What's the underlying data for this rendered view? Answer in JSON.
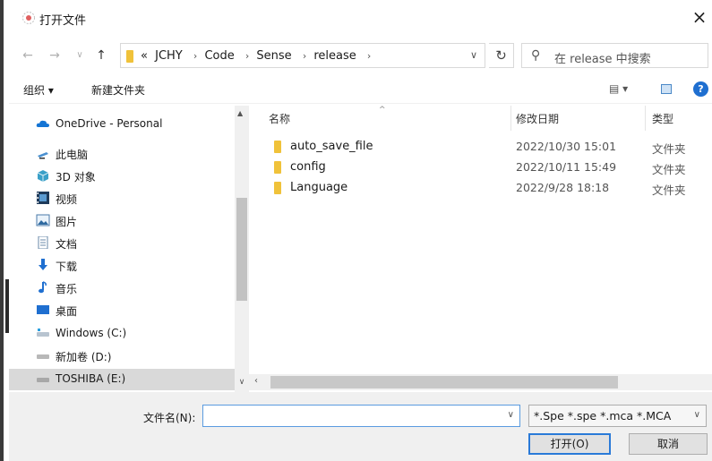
{
  "window": {
    "title": "打开文件",
    "close_label": "×"
  },
  "nav": {
    "back": "←",
    "forward": "→",
    "recent": "∨",
    "up": "↑",
    "breadcrumbs": [
      "«",
      "JCHY",
      "Code",
      "Sense",
      "release"
    ],
    "crumb_sep": "›",
    "refresh": "↻",
    "search_placeholder": "在 release 中搜索"
  },
  "toolbar": {
    "organize": "组织 ▾",
    "new_folder": "新建文件夹",
    "view": "▤ ▾",
    "help": "?"
  },
  "sidebar": {
    "items": [
      {
        "label": "OneDrive - Personal",
        "icon": "cloud-icon"
      },
      {
        "label": "此电脑",
        "icon": "computer-icon"
      },
      {
        "label": "3D 对象",
        "icon": "cube-icon"
      },
      {
        "label": "视频",
        "icon": "video-icon"
      },
      {
        "label": "图片",
        "icon": "picture-icon"
      },
      {
        "label": "文档",
        "icon": "document-icon"
      },
      {
        "label": "下载",
        "icon": "download-icon"
      },
      {
        "label": "音乐",
        "icon": "music-icon"
      },
      {
        "label": "桌面",
        "icon": "desktop-icon"
      },
      {
        "label": "Windows (C:)",
        "icon": "drive-icon"
      },
      {
        "label": "新加卷 (D:)",
        "icon": "drive-icon"
      },
      {
        "label": "TOSHIBA (E:)",
        "icon": "drive-icon"
      }
    ],
    "selected_index": 11
  },
  "files": {
    "columns": [
      "名称",
      "修改日期",
      "类型"
    ],
    "rows": [
      {
        "name": "auto_save_file",
        "date": "2022/10/30 15:01",
        "type": "文件夹"
      },
      {
        "name": "config",
        "date": "2022/10/11 15:49",
        "type": "文件夹"
      },
      {
        "name": "Language",
        "date": "2022/9/28 18:18",
        "type": "文件夹"
      }
    ]
  },
  "bottom": {
    "filename_label": "文件名(N):",
    "filename_value": "",
    "filetype_value": "*.Spe *.spe *.mca *.MCA",
    "open_button": "打开(O)",
    "cancel_button": "取消"
  },
  "colors": {
    "accent": "#2a7ad8",
    "folder": "#f0c23a",
    "selection": "#d9d9d9"
  }
}
